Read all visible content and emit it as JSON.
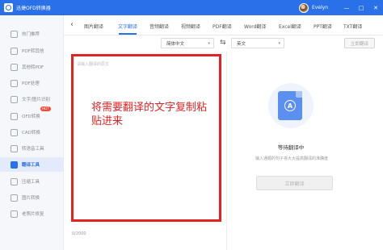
{
  "window": {
    "title": "迅捷OFD转换器",
    "user": "Evelyn",
    "controls": [
      "—",
      "□",
      "✕"
    ]
  },
  "sidebar": {
    "items": [
      {
        "label": "热门推荐",
        "icon": "home-icon"
      },
      {
        "label": "PDF转其他",
        "icon": "pdf-convert-icon"
      },
      {
        "label": "其他转PDF",
        "icon": "to-pdf-icon"
      },
      {
        "label": "PDF处理",
        "icon": "pdf-process-icon"
      },
      {
        "label": "文字/图片识别",
        "icon": "ocr-icon"
      },
      {
        "label": "OFD转换",
        "icon": "ofd-icon",
        "badge": "HOT"
      },
      {
        "label": "CAD转换",
        "icon": "cad-icon"
      },
      {
        "label": "转语音工具",
        "icon": "voice-icon"
      },
      {
        "label": "翻译工具",
        "icon": "translate-icon",
        "active": true
      },
      {
        "label": "压缩工具",
        "icon": "compress-icon"
      },
      {
        "label": "图片转换",
        "icon": "image-icon"
      },
      {
        "label": "老照片修复",
        "icon": "photo-repair-icon"
      }
    ]
  },
  "tabs": [
    "图片翻译",
    "文字翻译",
    "音频翻译",
    "视频翻译",
    "PDF翻译",
    "Word翻译",
    "Excel翻译",
    "PPT翻译",
    "TXT翻译"
  ],
  "active_tab": "文字翻译",
  "lang": {
    "source": "简体中文",
    "target": "英文",
    "translate_btn": "立即翻译"
  },
  "editor": {
    "placeholder": "请输入翻译的原文",
    "overlay": "将需要翻译的文字复制粘贴进来",
    "count": "0/2000"
  },
  "result": {
    "status": "等待翻译中",
    "hint": "输入通顺的句子将大大提高翻译的准确度",
    "button": "立即翻译"
  },
  "colors": {
    "accent": "#2a70e8",
    "highlight": "#e52222"
  }
}
